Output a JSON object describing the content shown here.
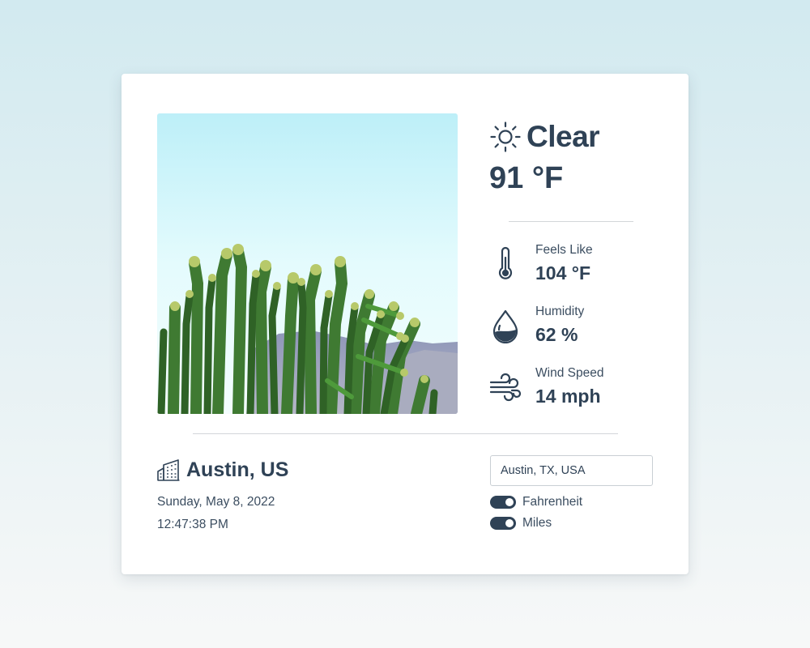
{
  "weather": {
    "condition": "Clear",
    "condition_icon": "sun-icon",
    "temperature": "91 °F"
  },
  "metrics": [
    {
      "label": "Feels Like",
      "value": "104 °F",
      "icon": "thermometer-icon"
    },
    {
      "label": "Humidity",
      "value": "62 %",
      "icon": "water-drop-icon"
    },
    {
      "label": "Wind Speed",
      "value": "14 mph",
      "icon": "wind-icon"
    }
  ],
  "location": {
    "city": "Austin, US",
    "icon": "city-buildings-icon",
    "date": "Sunday, May 8, 2022",
    "time": "12:47:38 PM"
  },
  "search": {
    "value": "Austin, TX, USA"
  },
  "toggles": [
    {
      "label": "Fahrenheit",
      "on": true
    },
    {
      "label": "Miles",
      "on": true
    }
  ],
  "photo": {
    "subject": "cactus-against-sky"
  },
  "colors": {
    "text_primary": "#2f4256",
    "toggle_on": "#2f4256",
    "background_top": "#d2eaf0",
    "background_bottom": "#f7f8f8",
    "card": "#ffffff"
  }
}
